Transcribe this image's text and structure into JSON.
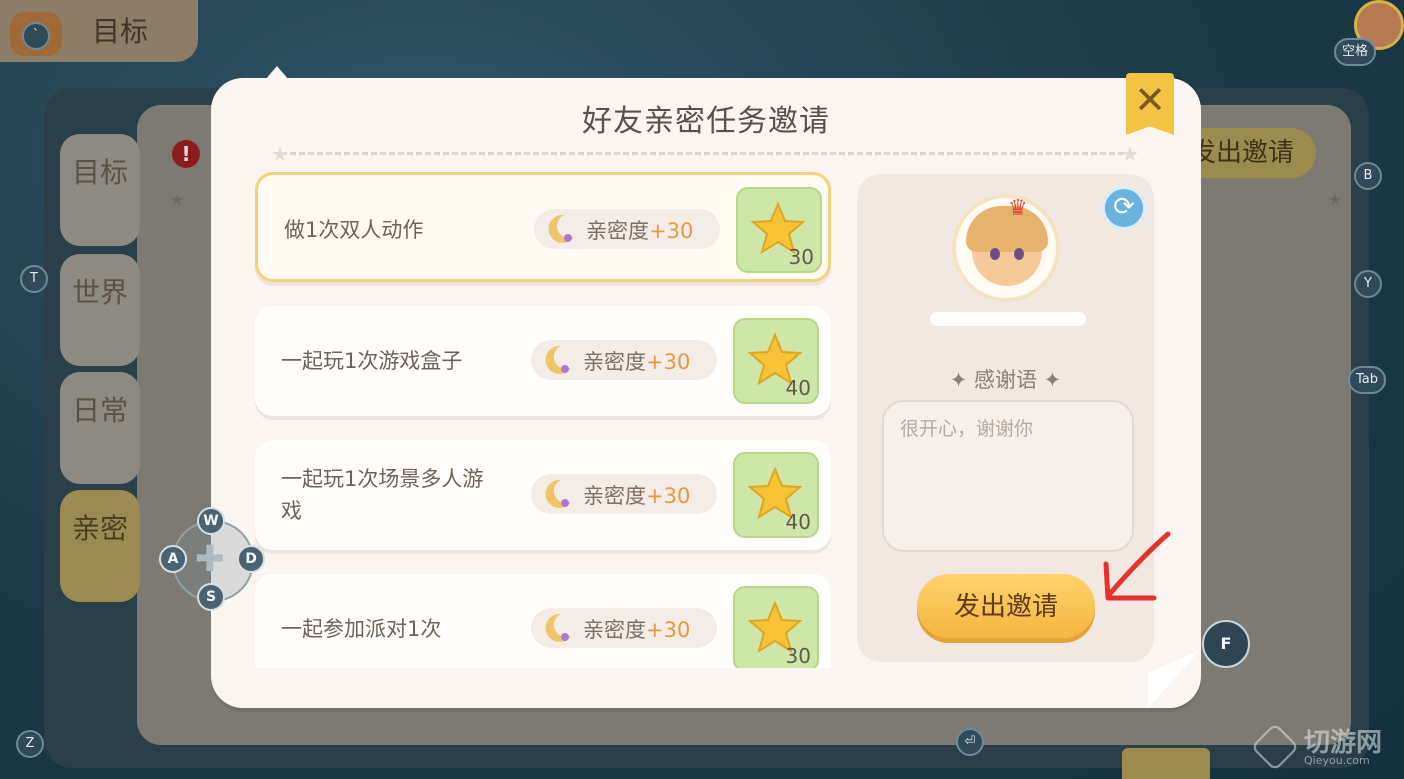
{
  "header": {
    "title": "目标"
  },
  "side_tabs": [
    {
      "label": "目标"
    },
    {
      "label": "世界"
    },
    {
      "label": "日常"
    },
    {
      "label": "亲密"
    }
  ],
  "background": {
    "invite_label": "发出邀请"
  },
  "key_hints": {
    "space": "空格",
    "b": "B",
    "t": "T",
    "y": "Y",
    "tab": "Tab",
    "z": "Z",
    "w": "W",
    "a": "A",
    "s": "S",
    "d": "D",
    "f": "F",
    "enter": "⏎"
  },
  "dialog": {
    "title": "好友亲密任务邀请",
    "close_icon": "close-icon",
    "tasks": [
      {
        "name": "做1次双人动作",
        "reward_label": "亲密度",
        "reward_value": "+30",
        "prize_count": "30",
        "selected": true
      },
      {
        "name": "一起玩1次游戏盒子",
        "reward_label": "亲密度",
        "reward_value": "+30",
        "prize_count": "40",
        "selected": false
      },
      {
        "name": "一起玩1次场景多人游戏",
        "reward_label": "亲密度",
        "reward_value": "+30",
        "prize_count": "40",
        "selected": false
      },
      {
        "name": "一起参加派对1次",
        "reward_label": "亲密度",
        "reward_value": "+30",
        "prize_count": "30",
        "selected": false
      }
    ],
    "thanks_label": "✦ 感谢语 ✦",
    "thanks_placeholder": "很开心，谢谢你",
    "invite_button": "发出邀请"
  },
  "watermark": {
    "name": "切游网",
    "url": "Qieyou.com"
  },
  "colors": {
    "dialog_bg": "#fbf5f1",
    "accent_yellow": "#f5b640",
    "prize_green": "#cfe6a9",
    "reward_orange": "#e29945",
    "annotation_red": "#e5322d"
  }
}
